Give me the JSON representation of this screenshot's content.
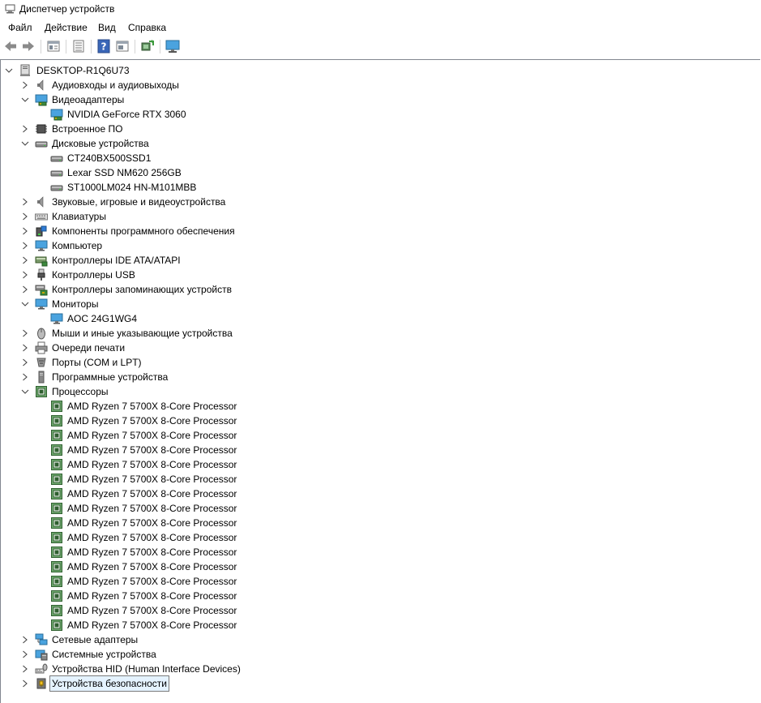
{
  "window": {
    "title": "Диспетчер устройств"
  },
  "menu": [
    "Файл",
    "Действие",
    "Вид",
    "Справка"
  ],
  "toolbar": [
    {
      "name": "back-arrow-icon",
      "icon": "back"
    },
    {
      "name": "forward-arrow-icon",
      "icon": "forward"
    },
    {
      "name": "properties-icon",
      "icon": "props"
    },
    {
      "name": "list-view-icon",
      "icon": "list"
    },
    {
      "name": "help-icon",
      "icon": "help"
    },
    {
      "name": "action-window-icon",
      "icon": "window"
    },
    {
      "name": "scan-hardware-icon",
      "icon": "scan"
    },
    {
      "name": "monitor-icon",
      "icon": "monitor"
    }
  ],
  "tree": [
    {
      "label": "DESKTOP-R1Q6U73",
      "level": 0,
      "state": "expanded",
      "icon": "computer"
    },
    {
      "label": "Аудиовходы и аудиовыходы",
      "level": 1,
      "state": "collapsed",
      "icon": "speaker"
    },
    {
      "label": "Видеоадаптеры",
      "level": 1,
      "state": "expanded",
      "icon": "display-adapter"
    },
    {
      "label": "NVIDIA GeForce RTX 3060",
      "level": 2,
      "state": "leaf",
      "icon": "display-adapter"
    },
    {
      "label": "Встроенное ПО",
      "level": 1,
      "state": "collapsed",
      "icon": "firmware"
    },
    {
      "label": "Дисковые устройства",
      "level": 1,
      "state": "expanded",
      "icon": "disk"
    },
    {
      "label": "CT240BX500SSD1",
      "level": 2,
      "state": "leaf",
      "icon": "disk"
    },
    {
      "label": "Lexar SSD NM620 256GB",
      "level": 2,
      "state": "leaf",
      "icon": "disk"
    },
    {
      "label": "ST1000LM024 HN-M101MBB",
      "level": 2,
      "state": "leaf",
      "icon": "disk"
    },
    {
      "label": "Звуковые, игровые и видеоустройства",
      "level": 1,
      "state": "collapsed",
      "icon": "speaker"
    },
    {
      "label": "Клавиатуры",
      "level": 1,
      "state": "collapsed",
      "icon": "keyboard"
    },
    {
      "label": "Компоненты программного обеспечения",
      "level": 1,
      "state": "collapsed",
      "icon": "software-component"
    },
    {
      "label": "Компьютер",
      "level": 1,
      "state": "collapsed",
      "icon": "monitor"
    },
    {
      "label": "Контроллеры IDE ATA/ATAPI",
      "level": 1,
      "state": "collapsed",
      "icon": "ide"
    },
    {
      "label": "Контроллеры USB",
      "level": 1,
      "state": "collapsed",
      "icon": "usb"
    },
    {
      "label": "Контроллеры запоминающих устройств",
      "level": 1,
      "state": "collapsed",
      "icon": "storage"
    },
    {
      "label": "Мониторы",
      "level": 1,
      "state": "expanded",
      "icon": "monitor"
    },
    {
      "label": "AOC 24G1WG4",
      "level": 2,
      "state": "leaf",
      "icon": "monitor"
    },
    {
      "label": "Мыши и иные указывающие устройства",
      "level": 1,
      "state": "collapsed",
      "icon": "mouse"
    },
    {
      "label": "Очереди печати",
      "level": 1,
      "state": "collapsed",
      "icon": "printer"
    },
    {
      "label": "Порты (COM и LPT)",
      "level": 1,
      "state": "collapsed",
      "icon": "port"
    },
    {
      "label": "Программные устройства",
      "level": 1,
      "state": "collapsed",
      "icon": "software-device"
    },
    {
      "label": "Процессоры",
      "level": 1,
      "state": "expanded",
      "icon": "cpu"
    },
    {
      "label": "AMD Ryzen 7 5700X 8-Core Processor",
      "level": 2,
      "state": "leaf",
      "icon": "cpu"
    },
    {
      "label": "AMD Ryzen 7 5700X 8-Core Processor",
      "level": 2,
      "state": "leaf",
      "icon": "cpu"
    },
    {
      "label": "AMD Ryzen 7 5700X 8-Core Processor",
      "level": 2,
      "state": "leaf",
      "icon": "cpu"
    },
    {
      "label": "AMD Ryzen 7 5700X 8-Core Processor",
      "level": 2,
      "state": "leaf",
      "icon": "cpu"
    },
    {
      "label": "AMD Ryzen 7 5700X 8-Core Processor",
      "level": 2,
      "state": "leaf",
      "icon": "cpu"
    },
    {
      "label": "AMD Ryzen 7 5700X 8-Core Processor",
      "level": 2,
      "state": "leaf",
      "icon": "cpu"
    },
    {
      "label": "AMD Ryzen 7 5700X 8-Core Processor",
      "level": 2,
      "state": "leaf",
      "icon": "cpu"
    },
    {
      "label": "AMD Ryzen 7 5700X 8-Core Processor",
      "level": 2,
      "state": "leaf",
      "icon": "cpu"
    },
    {
      "label": "AMD Ryzen 7 5700X 8-Core Processor",
      "level": 2,
      "state": "leaf",
      "icon": "cpu"
    },
    {
      "label": "AMD Ryzen 7 5700X 8-Core Processor",
      "level": 2,
      "state": "leaf",
      "icon": "cpu"
    },
    {
      "label": "AMD Ryzen 7 5700X 8-Core Processor",
      "level": 2,
      "state": "leaf",
      "icon": "cpu"
    },
    {
      "label": "AMD Ryzen 7 5700X 8-Core Processor",
      "level": 2,
      "state": "leaf",
      "icon": "cpu"
    },
    {
      "label": "AMD Ryzen 7 5700X 8-Core Processor",
      "level": 2,
      "state": "leaf",
      "icon": "cpu"
    },
    {
      "label": "AMD Ryzen 7 5700X 8-Core Processor",
      "level": 2,
      "state": "leaf",
      "icon": "cpu"
    },
    {
      "label": "AMD Ryzen 7 5700X 8-Core Processor",
      "level": 2,
      "state": "leaf",
      "icon": "cpu"
    },
    {
      "label": "AMD Ryzen 7 5700X 8-Core Processor",
      "level": 2,
      "state": "leaf",
      "icon": "cpu"
    },
    {
      "label": "Сетевые адаптеры",
      "level": 1,
      "state": "collapsed",
      "icon": "network"
    },
    {
      "label": "Системные устройства",
      "level": 1,
      "state": "collapsed",
      "icon": "system"
    },
    {
      "label": "Устройства HID (Human Interface Devices)",
      "level": 1,
      "state": "collapsed",
      "icon": "hid"
    },
    {
      "label": "Устройства безопасности",
      "level": 1,
      "state": "collapsed",
      "icon": "security",
      "selected": true
    }
  ]
}
